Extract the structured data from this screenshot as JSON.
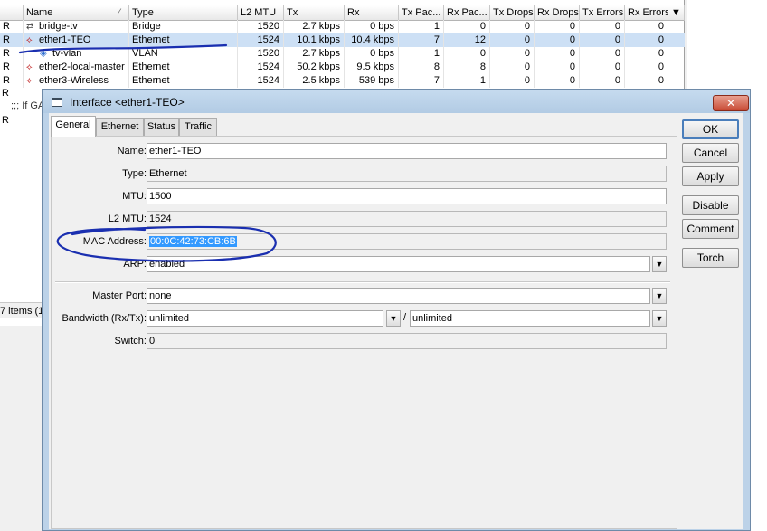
{
  "list": {
    "columns": [
      "Name",
      "Type",
      "L2 MTU",
      "Tx",
      "Rx",
      "Tx Pac...",
      "Rx Pac...",
      "Tx Drops",
      "Rx Drops",
      "Tx Errors",
      "Rx Errors"
    ],
    "rows": [
      {
        "flag": "R",
        "icon": "bridge-icon",
        "name": "bridge-tv",
        "type": "Bridge",
        "l2mtu": "1520",
        "tx": "2.7 kbps",
        "rx": "0 bps",
        "tx_packets": "1",
        "rx_packets": "0",
        "tx_drops": "0",
        "rx_drops": "0",
        "tx_errors": "0",
        "rx_errors": "0"
      },
      {
        "flag": "R",
        "icon": "ethernet-icon",
        "name": "ether1-TEO",
        "type": "Ethernet",
        "l2mtu": "1524",
        "tx": "10.1 kbps",
        "rx": "10.4 kbps",
        "tx_packets": "7",
        "rx_packets": "12",
        "tx_drops": "0",
        "rx_drops": "0",
        "tx_errors": "0",
        "rx_errors": "0"
      },
      {
        "flag": "R",
        "icon": "vlan-icon",
        "name": "tv-vlan",
        "type": "VLAN",
        "l2mtu": "1520",
        "tx": "2.7 kbps",
        "rx": "0 bps",
        "tx_packets": "1",
        "rx_packets": "0",
        "tx_drops": "0",
        "rx_drops": "0",
        "tx_errors": "0",
        "rx_errors": "0"
      },
      {
        "flag": "R",
        "icon": "ethernet-icon",
        "name": "ether2-local-master",
        "type": "Ethernet",
        "l2mtu": "1524",
        "tx": "50.2 kbps",
        "rx": "9.5 kbps",
        "tx_packets": "8",
        "rx_packets": "8",
        "tx_drops": "0",
        "rx_drops": "0",
        "tx_errors": "0",
        "rx_errors": "0"
      },
      {
        "flag": "R",
        "icon": "ethernet-icon",
        "name": "ether3-Wireless",
        "type": "Ethernet",
        "l2mtu": "1524",
        "tx": "2.5 kbps",
        "rx": "539 bps",
        "tx_packets": "7",
        "rx_packets": "1",
        "tx_drops": "0",
        "rx_drops": "0",
        "tx_errors": "0",
        "rx_errors": "0"
      }
    ],
    "extra_flag_1": "R",
    "filter_text": ";;; If GA",
    "extra_flag_2": "R",
    "items_count": "7 items (1"
  },
  "dialog": {
    "title": "Interface <ether1-TEO>",
    "close_glyph": "✕",
    "tabs": [
      "General",
      "Ethernet",
      "Status",
      "Traffic"
    ],
    "fields": {
      "name_label": "Name:",
      "name_value": "ether1-TEO",
      "type_label": "Type:",
      "type_value": "Ethernet",
      "mtu_label": "MTU:",
      "mtu_value": "1500",
      "l2mtu_label": "L2 MTU:",
      "l2mtu_value": "1524",
      "mac_label": "MAC Address:",
      "mac_value": "00:0C:42:73:CB:6B",
      "arp_label": "ARP:",
      "arp_value": "enabled",
      "master_port_label": "Master Port:",
      "master_port_value": "none",
      "bandwidth_label": "Bandwidth (Rx/Tx):",
      "bandwidth_rx": "unlimited",
      "bandwidth_separator": "/",
      "bandwidth_tx": "unlimited",
      "switch_label": "Switch:",
      "switch_value": "0"
    },
    "buttons": {
      "ok": "OK",
      "cancel": "Cancel",
      "apply": "Apply",
      "disable": "Disable",
      "comment": "Comment",
      "torch": "Torch"
    },
    "dropdown_glyph": "▼",
    "annotation_color": "#1a2fb0",
    "selection_color": "#3399ff"
  }
}
